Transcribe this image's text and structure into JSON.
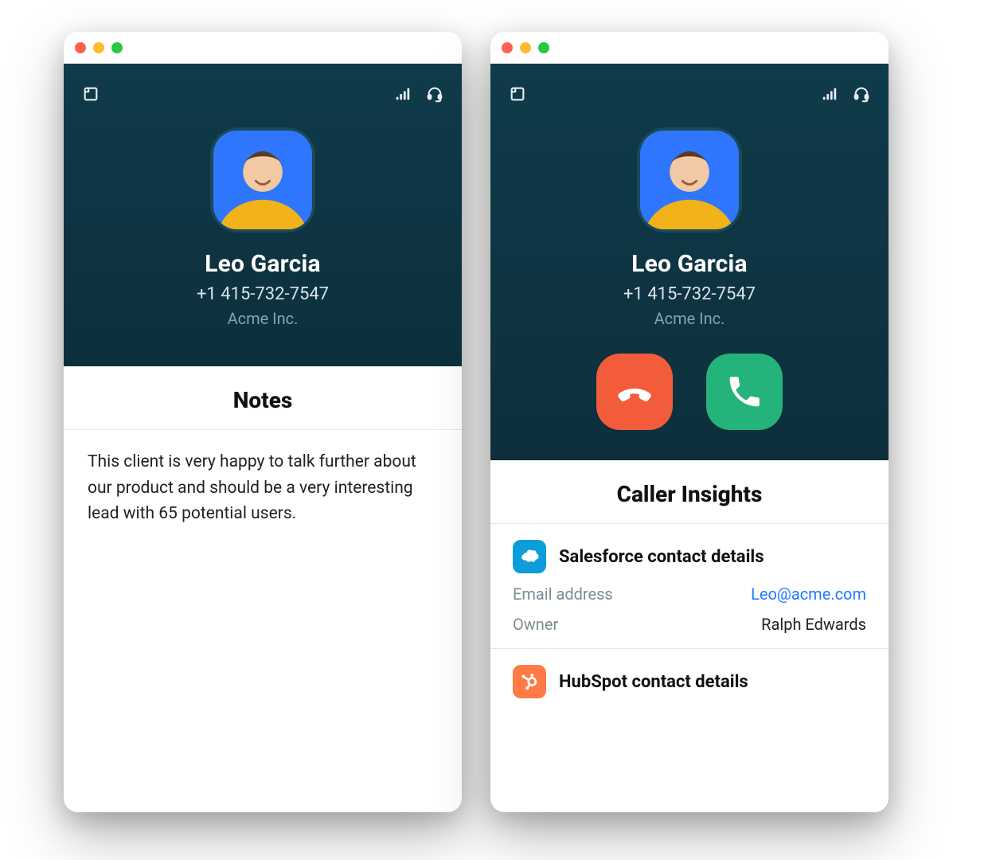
{
  "contact": {
    "name": "Leo Garcia",
    "phone": "+1 415-732-7547",
    "company": "Acme Inc."
  },
  "left": {
    "panel_title": "Notes",
    "note_body": "This client is very happy to talk further about our product and should be a very interesting lead with 65 potential users."
  },
  "right": {
    "panel_title": "Caller Insights",
    "salesforce": {
      "title": "Salesforce contact details",
      "email_label": "Email address",
      "email_value": "Leo@acme.com",
      "owner_label": "Owner",
      "owner_value": "Ralph Edwards"
    },
    "hubspot": {
      "title": "HubSpot contact details"
    }
  },
  "colors": {
    "hangup": "#f25c3b",
    "answer": "#24b37a",
    "salesforce": "#0d9ddb",
    "hubspot": "#ff7a45",
    "link": "#1f7aff"
  }
}
